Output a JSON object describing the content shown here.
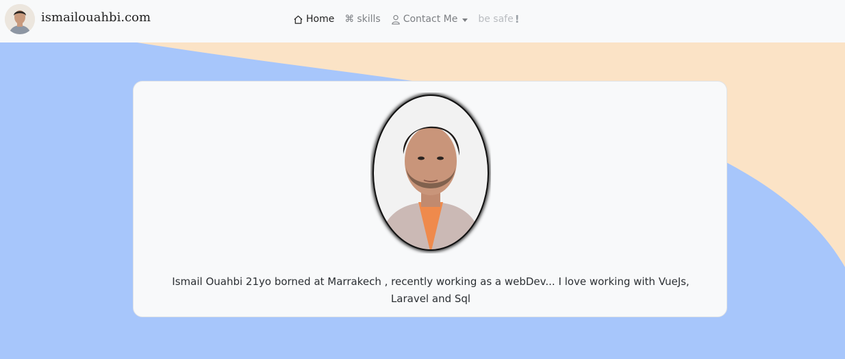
{
  "brand": {
    "name": "ismailouahbi.com"
  },
  "nav": {
    "home": "Home",
    "skills": "skills",
    "contact": "Contact Me",
    "safe": "be safe",
    "safe_mark": "!"
  },
  "card": {
    "bio": "Ismail Ouahbi 21yo borned at Marrakech , recently working as a webDev... I love working with VueJs, Laravel and Sql"
  },
  "colors": {
    "page_background": "#a7c6fb",
    "accent_shape": "#fbe3c6",
    "navbar": "#f8f9fa",
    "card": "#f8f9fa"
  }
}
